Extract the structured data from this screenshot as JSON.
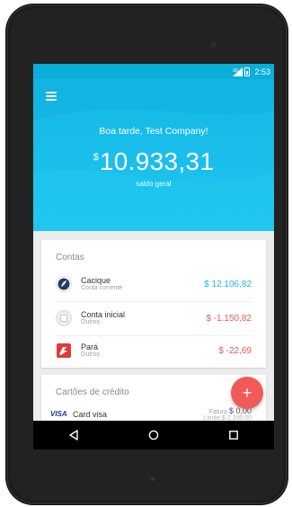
{
  "status_bar": {
    "network": "3G",
    "time": "2:53"
  },
  "header": {
    "greeting": "Boa tarde, Test Company!",
    "currency_symbol": "$",
    "balance": "10.933,31",
    "balance_label": "saldo geral"
  },
  "accounts": {
    "title": "Contas",
    "items": [
      {
        "name": "Cacique",
        "type": "Conta corrente",
        "value": "$ 12.106,82",
        "icon": "cacique-icon"
      },
      {
        "name": "Conta inicial",
        "type": "Outros",
        "value": "$ -1.150,82",
        "icon": "wallet-icon"
      },
      {
        "name": "Pará",
        "type": "Outros",
        "value": "$ -22,69",
        "icon": "banpara-icon"
      }
    ]
  },
  "credit_cards": {
    "title": "Cartões de crédito",
    "items": [
      {
        "brand": "VISA",
        "name": "Card visa",
        "invoice_label": "Fatura",
        "invoice_value": "$ 0,00",
        "limit_label": "Limite $ 2.200,00"
      }
    ]
  },
  "fab": {
    "label": "+"
  },
  "colors": {
    "primary": "#1ec4ef",
    "positive": "#1fb8e1",
    "negative": "#e95555",
    "fab": "#f25a5a"
  }
}
